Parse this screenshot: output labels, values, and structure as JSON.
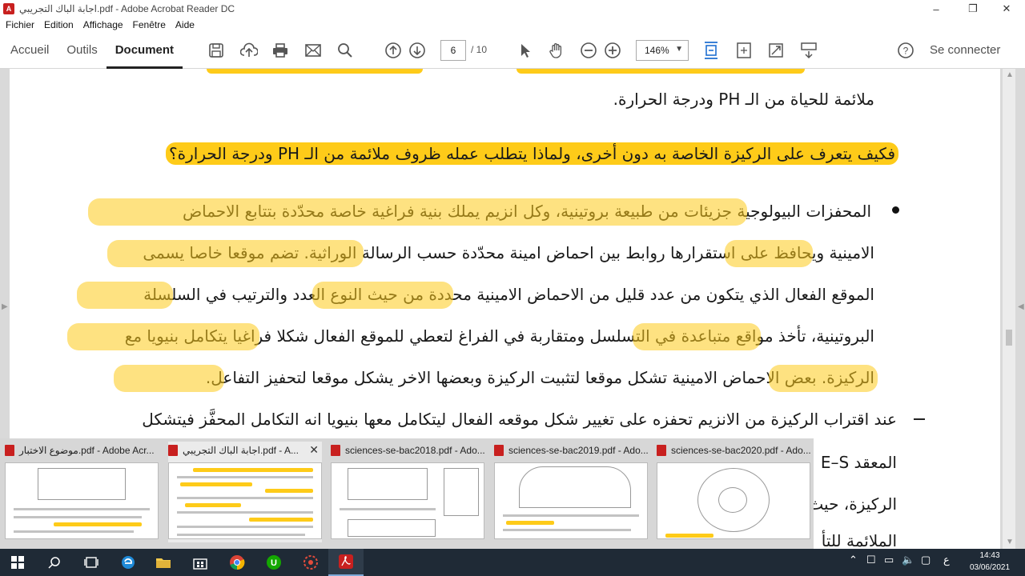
{
  "window": {
    "title": "اجابة الباك التجريبي.pdf - Adobe Acrobat Reader DC",
    "minimize": "–",
    "restore": "❐",
    "close": "✕"
  },
  "menu": [
    "Fichier",
    "Edition",
    "Affichage",
    "Fenêtre",
    "Aide"
  ],
  "tabs": {
    "home": "Accueil",
    "tools": "Outils",
    "document": "Document"
  },
  "toolbar": {
    "current_page": "6",
    "total_pages": "/ 10",
    "zoom": "146%",
    "sign_in": "Se connecter"
  },
  "document": {
    "line1": "ملائمة للحياة من الـ PH ودرجة الحرارة.",
    "question": "فكيف يتعرف على الركيزة الخاصة به دون أخرى، ولماذا يتطلب عمله ظروف ملائمة من الـ PH ودرجة الحرارة؟",
    "p1": "المحفزات البيولوجية جزيئات من طبيعة بروتينية، وكل انزيم يملك بنية فراغية خاصة محدّدة بتتابع الاحماض",
    "p2": "الامينية ويحافظ على استقرارها روابط بين احماض امينة محدّدة حسب الرسالة الوراثية. تضم موقعا خاصا يسمى",
    "p3": "الموقع الفعال الذي يتكون من عدد قليل من الاحماض الامينية محددة من حيث النوع العدد والترتيب في السلسلة",
    "p4": "البروتينية، تأخذ مواقع متباعدة في التسلسل ومتقاربة في الفراغ لتعطي للموقع الفعال شكلا فراغيا يتكامل بنيويا مع",
    "p5": "الركيزة. بعض الاحماض الامينية تشكل موقعا لتثبيت الركيزة وبعضها الاخر يشكل موقعا لتحفيز التفاعل.",
    "p6": "عند اقتراب الركيزة من الانزيم تحفزه على تغيير شكل موقعه الفعال ليتكامل معها بنيويا انه التكامل المحفَّز فيتشكل",
    "p7_fragment": "المعقد E–S",
    "p8_fragment": "الركيزة، حيث",
    "p9_fragment": "الملائمة للتأ"
  },
  "thumbnails": [
    {
      "title": "موضوع الاختبار.pdf - Adobe Acr..."
    },
    {
      "title": "اجابة الباك التجريبي.pdf - A...",
      "close": "✕"
    },
    {
      "title": "sciences-se-bac2018.pdf - Ado..."
    },
    {
      "title": "sciences-se-bac2019.pdf - Ado..."
    },
    {
      "title": "sciences-se-bac2020.pdf - Ado..."
    }
  ],
  "taskbar": {
    "time": "14:43",
    "date": "03/06/2021",
    "lang": "ع"
  },
  "colors": {
    "highlight": "#fecb19",
    "acrobat_red": "#c8201f",
    "taskbar": "#1f2a36"
  }
}
